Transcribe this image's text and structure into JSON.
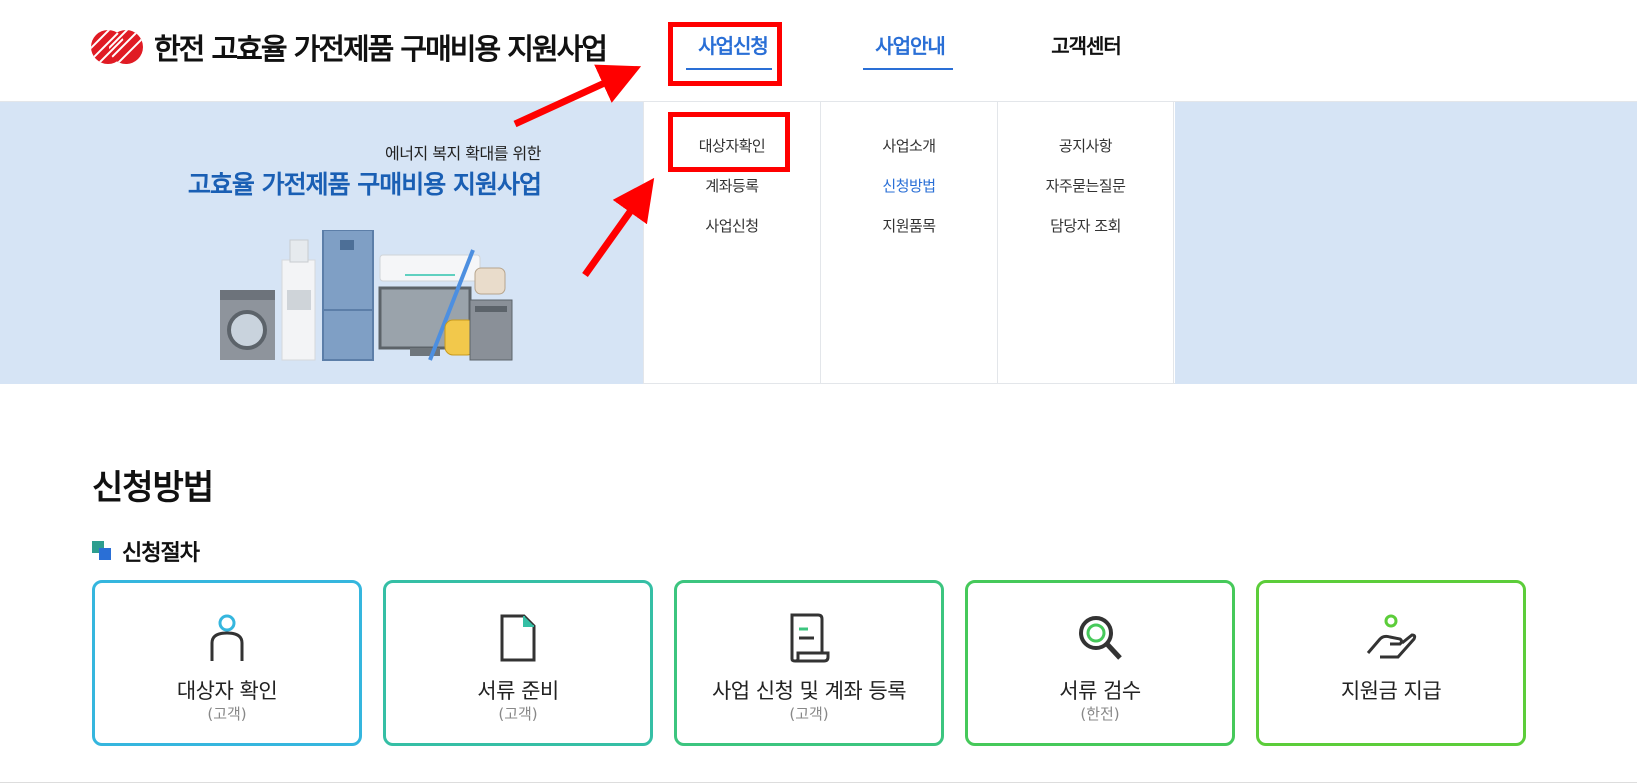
{
  "header": {
    "logo_text": "한전 고효율 가전제품 구매비용 지원사업",
    "nav": [
      {
        "label": "사업신청"
      },
      {
        "label": "사업안내"
      },
      {
        "label": "고객센터"
      }
    ]
  },
  "banner": {
    "subtitle": "에너지 복지 확대를 위한",
    "title": "고효율 가전제품 구매비용 지원사업"
  },
  "dropdown": {
    "columns": [
      {
        "items": [
          "대상자확인",
          "계좌등록",
          "사업신청"
        ]
      },
      {
        "items": [
          "사업소개",
          "신청방법",
          "지원품목"
        ]
      },
      {
        "items": [
          "공지사항",
          "자주묻는질문",
          "담당자 조회"
        ]
      }
    ]
  },
  "main": {
    "page_title": "신청방법",
    "section_title": "신청절차",
    "steps": [
      {
        "label": "대상자 확인",
        "who": "(고객)",
        "icon": "person-icon",
        "color": "#35b6de"
      },
      {
        "label": "서류 준비",
        "who": "(고객)",
        "icon": "document-icon",
        "color": "#35bfa5"
      },
      {
        "label": "사업 신청 및 계좌 등록",
        "who": "(고객)",
        "icon": "receipt-icon",
        "color": "#3cc57f"
      },
      {
        "label": "서류 검수",
        "who": "(한전)",
        "icon": "magnifier-icon",
        "color": "#46c95a"
      },
      {
        "label": "지원금 지급",
        "who": "",
        "icon": "hand-coin-icon",
        "color": "#5ccd3a"
      }
    ]
  },
  "colors": {
    "accent": "#2a6fd6",
    "banner_bg": "#d6e4f5",
    "annotation_red": "#ff0000"
  }
}
